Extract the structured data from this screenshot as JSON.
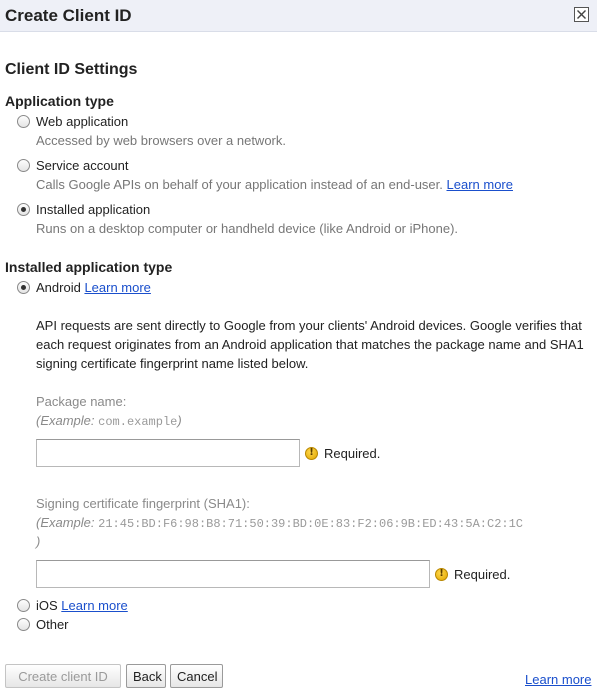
{
  "dialog": {
    "title": "Create Client ID"
  },
  "section_title": "Client ID Settings",
  "application_type": {
    "heading": "Application type",
    "options": [
      {
        "label": "Web application",
        "description": "Accessed by web browsers over a network.",
        "checked": false
      },
      {
        "label": "Service account",
        "description": "Calls Google APIs on behalf of your application instead of an end-user.",
        "learn_more": "Learn more",
        "checked": false
      },
      {
        "label": "Installed application",
        "description": "Runs on a desktop computer or handheld device (like Android or iPhone).",
        "checked": true
      }
    ]
  },
  "installed_type": {
    "heading": "Installed application type",
    "android": {
      "label": "Android",
      "learn_more": "Learn more",
      "checked": true
    },
    "explanation": "API requests are sent directly to Google from your clients' Android devices. Google verifies that each request originates from an Android application that matches the package name and SHA1 signing certificate fingerprint name listed below.",
    "package": {
      "label": "Package name:",
      "example_prefix": "(Example: ",
      "example_value": "com.example",
      "example_suffix": ")",
      "value": "",
      "required": "Required."
    },
    "sha1": {
      "label": "Signing certificate fingerprint (SHA1):",
      "example_prefix": "(Example: ",
      "example_value": "21:45:BD:F6:98:B8:71:50:39:BD:0E:83:F2:06:9B:ED:43:5A:C2:1C",
      "example_suffix": ")",
      "value": "",
      "required": "Required."
    },
    "ios": {
      "label": "iOS",
      "learn_more": "Learn more",
      "checked": false
    },
    "other": {
      "label": "Other",
      "checked": false
    }
  },
  "footer": {
    "create_label": "Create client ID",
    "back_label": "Back",
    "cancel_label": "Cancel",
    "learn_more": "Learn more"
  },
  "icons": {
    "close": "close-icon",
    "warning": "warning-icon"
  },
  "colors": {
    "link": "#1a4fcc",
    "titlebar": "#eef0f7",
    "warning": "#e0a400"
  }
}
